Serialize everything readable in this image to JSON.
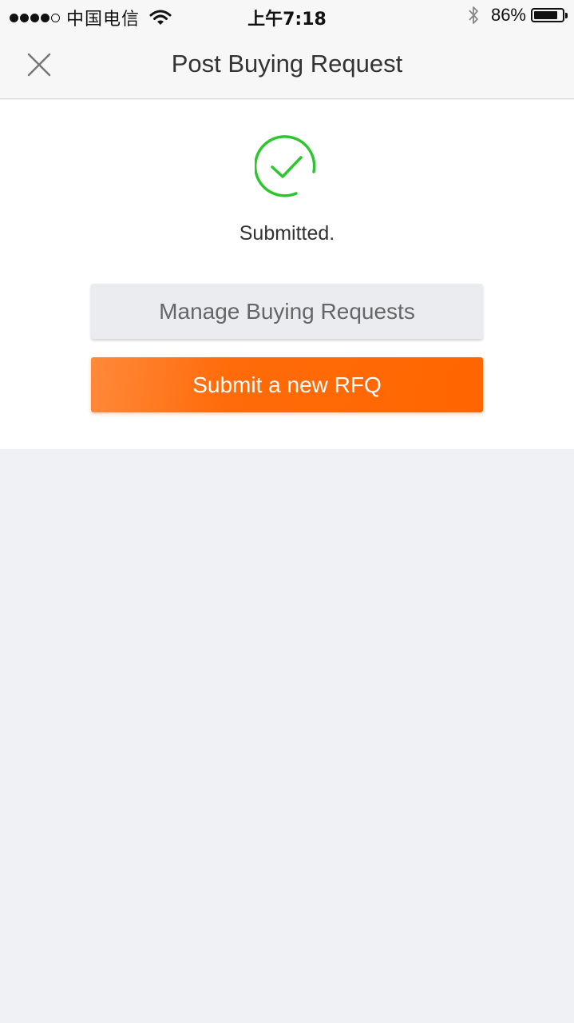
{
  "status_bar": {
    "carrier": "中国电信",
    "time": "上午7:18",
    "battery_percent": "86%",
    "battery_level": 0.86
  },
  "nav": {
    "title": "Post Buying Request"
  },
  "result": {
    "message": "Submitted.",
    "icon": "check-circle-icon",
    "icon_color": "#2dc72d"
  },
  "actions": {
    "manage_label": "Manage Buying Requests",
    "submit_label": "Submit a new RFQ",
    "accent_color": "#ff6a00"
  }
}
